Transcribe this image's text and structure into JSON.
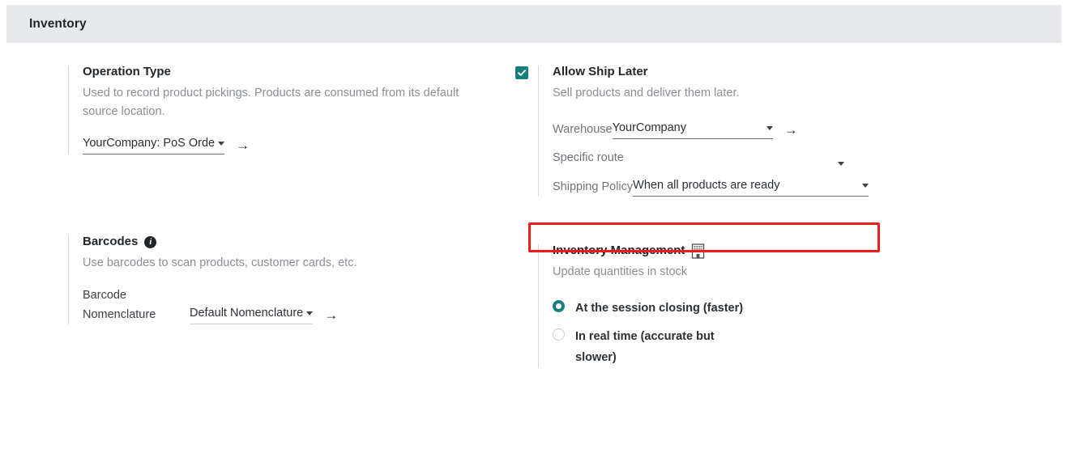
{
  "header": {
    "title": "Inventory"
  },
  "left_column": {
    "operation_type": {
      "title": "Operation Type",
      "description": "Used to record product pickings. Products are consumed from its default source location.",
      "field": {
        "value": "YourCompany: PoS Orde",
        "caret_icon": "chevron-down-icon",
        "link_icon": "arrow-right-icon"
      }
    },
    "barcodes": {
      "title": "Barcodes",
      "info_icon": "info-icon",
      "info_glyph": "i",
      "description": "Use barcodes to scan products, customer cards, etc.",
      "field": {
        "label": "Barcode Nomenclature",
        "value": "Default Nomenclature",
        "caret_icon": "chevron-down-icon",
        "link_icon": "arrow-right-icon"
      }
    }
  },
  "right_column": {
    "allow_ship_later": {
      "title": "Allow Ship Later",
      "description": "Sell products and deliver them later.",
      "checkbox_checked": true,
      "checkbox_icon": "checkmark-icon",
      "fields": [
        {
          "label": "Warehouse",
          "value": "YourCompany",
          "caret_icon": "chevron-down-icon",
          "link_icon": "arrow-right-icon"
        },
        {
          "label": "Specific route",
          "value": "",
          "caret_icon": "chevron-down-icon"
        },
        {
          "label": "Shipping Policy",
          "value": "When all products are ready",
          "caret_icon": "chevron-down-icon",
          "highlighted": true
        }
      ]
    },
    "inventory_management": {
      "title": "Inventory Management",
      "title_icon": "building-icon",
      "description": "Update quantities in stock",
      "options": [
        {
          "label": "At the session closing (faster)",
          "selected": true
        },
        {
          "label": "In real time (accurate but slower)",
          "selected": false
        }
      ]
    }
  },
  "colors": {
    "accent_teal": "#17807f",
    "highlight_red": "#ef1b1b",
    "header_gray": "#e7e9ed",
    "muted_text": "#8a8f94"
  }
}
